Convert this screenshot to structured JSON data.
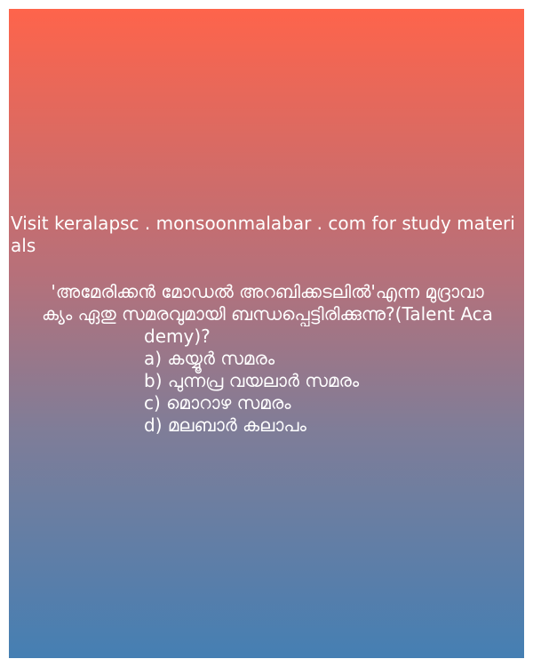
{
  "promo_text": "Visit keralapsc . monsoonmalabar . com for study materials",
  "question": {
    "line1": "'അമേരിക്കൻ മോഡൽ അറബിക്കടലിൽ'എന്ന മുദ്രാവാ",
    "line2": "ക്യം ഏതു സമരവുമായി ബന്ധപ്പെട്ടിരിക്കുന്നു?(Talent Aca",
    "line3": "demy)?"
  },
  "options": [
    "a) കയ്യൂർ സമരം",
    "b) പുന്നപ്ര വയലാർ സമരം",
    "c) മൊറാഴ സമരം",
    "d) മലബാർ കലാപം"
  ],
  "colors": {
    "gradient_top": "#fe644b",
    "gradient_bottom": "#457fb3",
    "text": "#ffffff"
  }
}
